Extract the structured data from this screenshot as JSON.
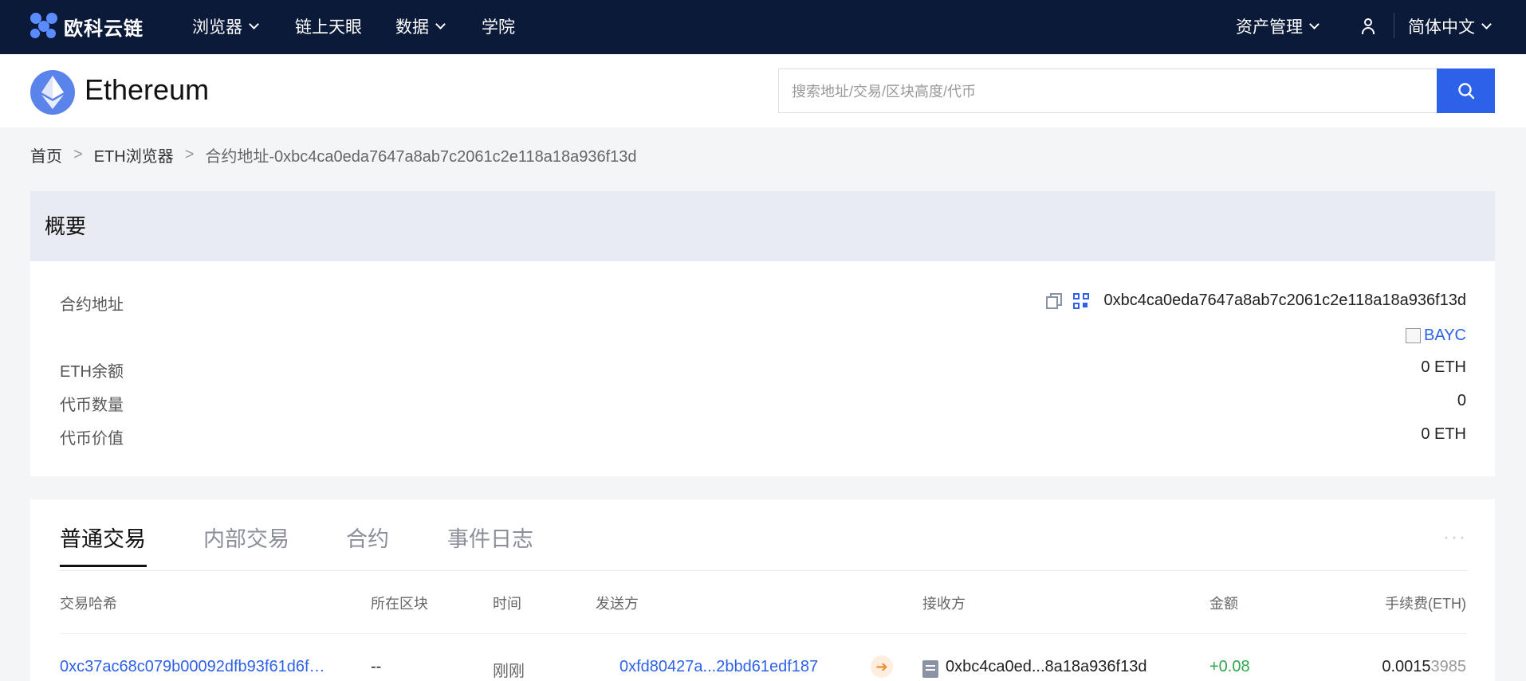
{
  "brand": {
    "name": "欧科云链"
  },
  "nav": {
    "browser": "浏览器",
    "onchain": "链上天眼",
    "data": "数据",
    "academy": "学院",
    "assets": "资产管理",
    "language": "简体中文"
  },
  "header": {
    "chain_name": "Ethereum",
    "search_placeholder": "搜索地址/交易/区块高度/代币"
  },
  "breadcrumb": {
    "home": "首页",
    "separator": ">",
    "explorer": "ETH浏览器",
    "current": "合约地址-0xbc4ca0eda7647a8ab7c2061c2e118a18a936f13d"
  },
  "overview": {
    "title": "概要",
    "contract_address_label": "合约地址",
    "contract_address": "0xbc4ca0eda7647a8ab7c2061c2e118a18a936f13d",
    "token_symbol": "BAYC",
    "eth_balance_label": "ETH余额",
    "eth_balance": "0 ETH",
    "token_count_label": "代币数量",
    "token_count": "0",
    "token_value_label": "代币价值",
    "token_value": "0 ETH"
  },
  "tabs": [
    "普通交易",
    "内部交易",
    "合约",
    "事件日志"
  ],
  "more": "···",
  "table": {
    "columns": [
      "交易哈希",
      "所在区块",
      "时间",
      "发送方",
      "接收方",
      "金额",
      "手续费(ETH)"
    ],
    "rows": [
      {
        "hash": "0xc37ac68c079b00092dfb93f61d6f…",
        "block": "--",
        "time": "刚刚",
        "from": "0xfd80427a...2bbd61edf187",
        "to": "0xbc4ca0ed...8a18a936f13d",
        "amount": "+0.08",
        "fee_main": "0.0015",
        "fee_tail": "3985"
      }
    ]
  },
  "colors": {
    "topbar": "#0c1a3a",
    "accent": "#2d62e8",
    "positive": "#2fa84f",
    "arrow": "#f08a24"
  },
  "icons": [
    "chevron-down-icon",
    "user-icon",
    "ethereum-icon",
    "search-icon",
    "copy-icon",
    "qr-code-icon",
    "token-checkbox-icon",
    "arrow-right-icon",
    "contract-icon",
    "more-icon"
  ]
}
